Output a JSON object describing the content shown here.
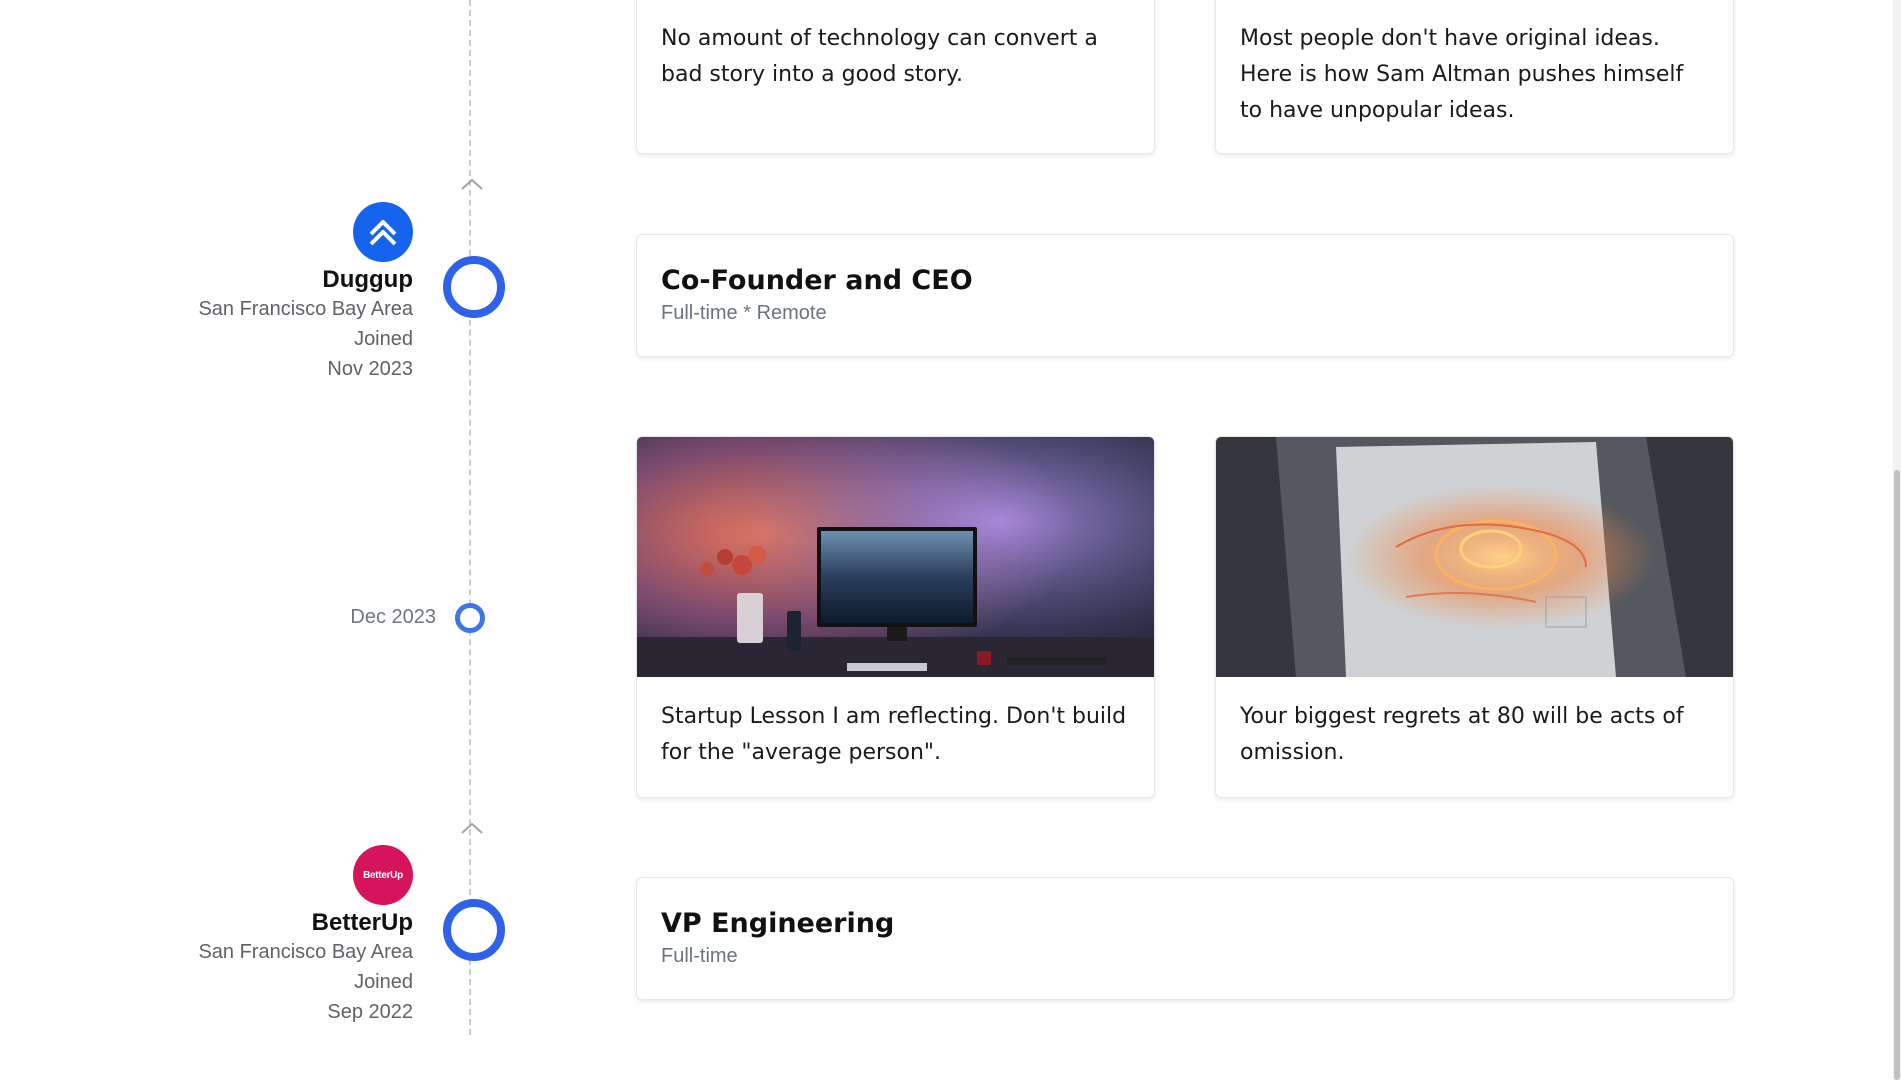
{
  "posts": {
    "top_left": "No amount of technology can convert a bad story into a good story.",
    "top_right": "Most people don't have original ideas. Here is how Sam Altman pushes himself to have unpopular ideas.",
    "mid_left": "Startup Lesson I am reflecting. Don't build for the \"average person\".",
    "mid_right": "Your biggest regrets at 80 will be acts of omission."
  },
  "companies": [
    {
      "name": "Duggup",
      "location": "San Francisco Bay Area",
      "joined_label": "Joined",
      "joined_date": "Nov 2023",
      "logo_color": "#1664ee",
      "logo_icon": "double-chevron-up-icon",
      "role": "Co-Founder and CEO",
      "role_meta": "Full-time * Remote"
    },
    {
      "name": "BetterUp",
      "location": "San Francisco Bay Area",
      "joined_label": "Joined",
      "joined_date": "Sep 2022",
      "logo_color": "#d5145b",
      "logo_text": "BetterUp",
      "role": "VP Engineering",
      "role_meta": "Full-time"
    }
  ],
  "timeline": {
    "date_marker": "Dec 2023",
    "accent_color": "#2f62e8"
  }
}
